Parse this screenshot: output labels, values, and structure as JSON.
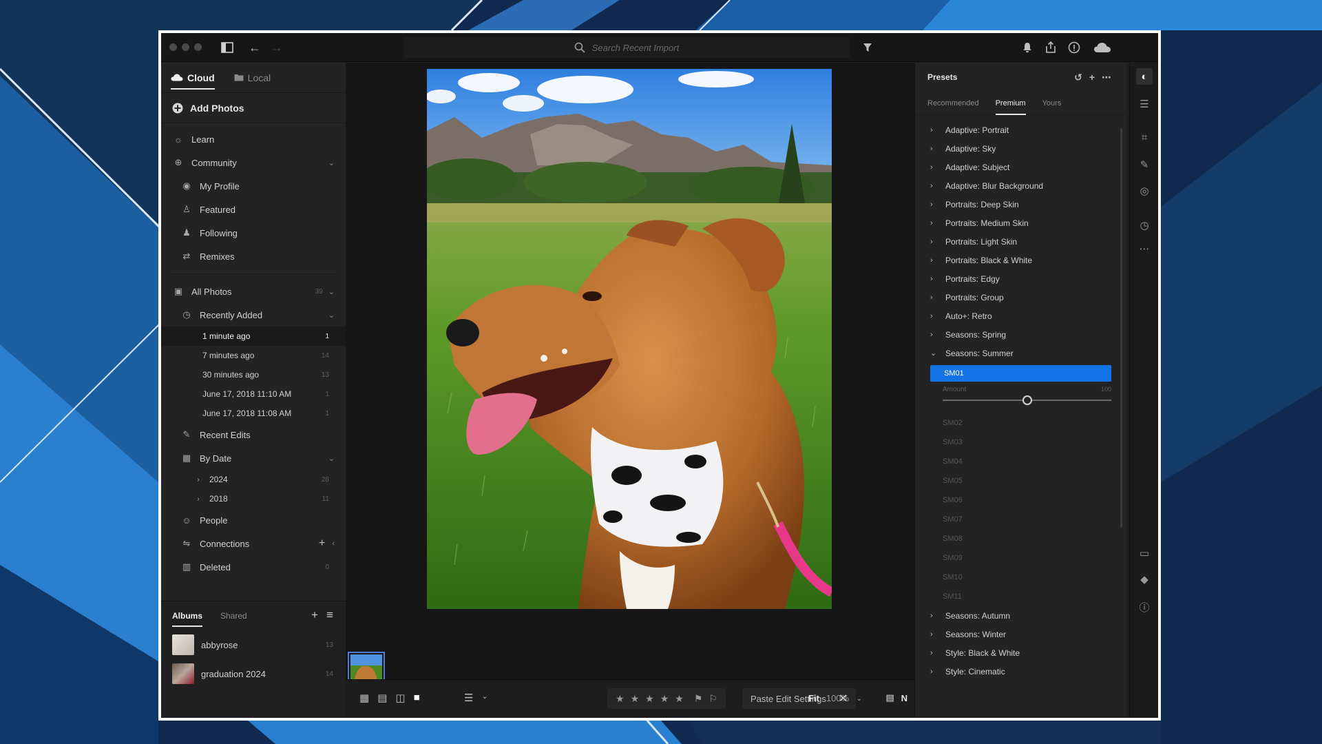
{
  "topbar": {
    "search_placeholder": "Search Recent Import"
  },
  "left": {
    "tabs": [
      "Cloud",
      "Local"
    ],
    "add_photos": "Add Photos",
    "nav": {
      "learn": "Learn",
      "community": "Community",
      "my_profile": "My Profile",
      "featured": "Featured",
      "following": "Following",
      "remixes": "Remixes",
      "all_photos": "All Photos",
      "all_photos_count": "39",
      "recently_added": "Recently Added",
      "recent": [
        {
          "label": "1 minute ago",
          "count": "1"
        },
        {
          "label": "7 minutes ago",
          "count": "14"
        },
        {
          "label": "30 minutes ago",
          "count": "13"
        },
        {
          "label": "June 17, 2018 11:10 AM",
          "count": "1"
        },
        {
          "label": "June 17, 2018 11:08 AM",
          "count": "1"
        }
      ],
      "recent_edits": "Recent Edits",
      "by_date": "By Date",
      "years": [
        {
          "label": "2024",
          "count": "28"
        },
        {
          "label": "2018",
          "count": "11"
        }
      ],
      "people": "People",
      "connections": "Connections",
      "deleted": "Deleted",
      "deleted_count": "0"
    },
    "albums": {
      "tabs": [
        "Albums",
        "Shared"
      ],
      "items": [
        {
          "name": "abbyrose",
          "count": "13"
        },
        {
          "name": "graduation 2024",
          "count": "14"
        }
      ]
    }
  },
  "bottombar": {
    "paste_label": "Paste Edit Settings",
    "fit_label": "Fit",
    "zoom_value": "100%"
  },
  "presets": {
    "title": "Presets",
    "tabs": [
      "Recommended",
      "Premium",
      "Yours"
    ],
    "groups_before": [
      "Adaptive: Portrait",
      "Adaptive: Sky",
      "Adaptive: Subject",
      "Adaptive: Blur Background",
      "Portraits: Deep Skin",
      "Portraits: Medium Skin",
      "Portraits: Light Skin",
      "Portraits: Black & White",
      "Portraits: Edgy",
      "Portraits: Group",
      "Auto+: Retro",
      "Seasons: Spring"
    ],
    "expanded_group": "Seasons: Summer",
    "selected": "SM01",
    "amount_label": "Amount",
    "amount_value": "100",
    "amount_fraction": 0.5,
    "sub_items": [
      "SM02",
      "SM03",
      "SM04",
      "SM05",
      "SM06",
      "SM07",
      "SM08",
      "SM09",
      "SM10",
      "SM11"
    ],
    "groups_after": [
      "Seasons: Autumn",
      "Seasons: Winter",
      "Style: Black & White",
      "Style: Cinematic"
    ]
  },
  "colors": {
    "accent": "#1473e6",
    "panel": "#232323",
    "canvas": "#161616"
  }
}
